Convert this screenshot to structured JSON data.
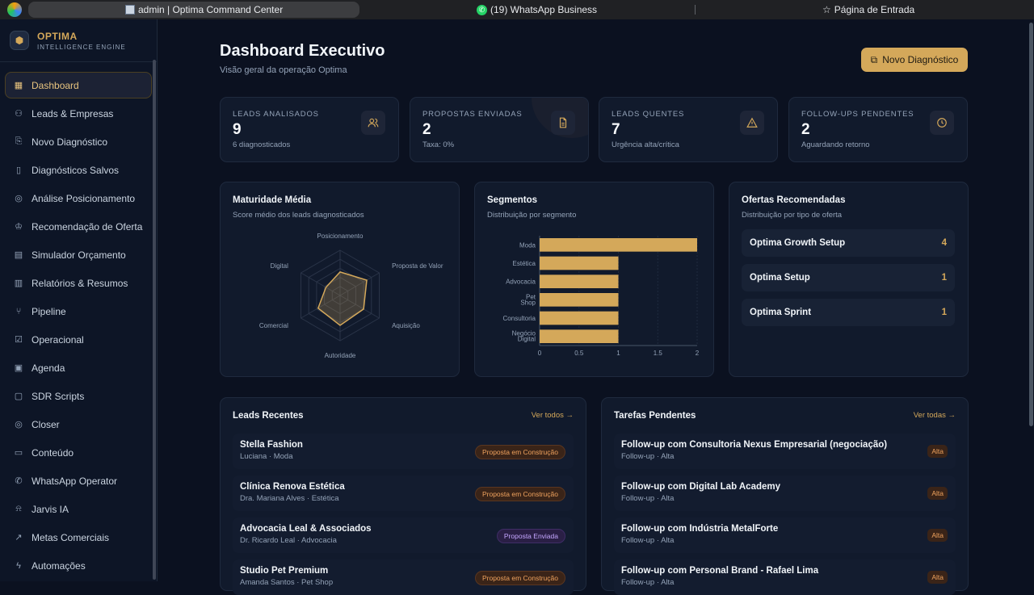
{
  "browser": {
    "active_tab": "admin | Optima Command Center",
    "tab2": "(19) WhatsApp Business",
    "tab3": "Página de Entrada"
  },
  "brand": {
    "name": "OPTIMA",
    "tagline": "INTELLIGENCE ENGINE"
  },
  "sidebar": {
    "items": [
      {
        "label": "Dashboard",
        "icon": "grid-icon"
      },
      {
        "label": "Leads & Empresas",
        "icon": "users-icon"
      },
      {
        "label": "Novo Diagnóstico",
        "icon": "file-plus-icon"
      },
      {
        "label": "Diagnósticos Salvos",
        "icon": "book-icon"
      },
      {
        "label": "Análise Posicionamento",
        "icon": "target-icon"
      },
      {
        "label": "Recomendação de Oferta",
        "icon": "award-icon"
      },
      {
        "label": "Simulador Orçamento",
        "icon": "calculator-icon"
      },
      {
        "label": "Relatórios & Resumos",
        "icon": "bar-chart-icon"
      },
      {
        "label": "Pipeline",
        "icon": "git-branch-icon"
      },
      {
        "label": "Operacional",
        "icon": "checklist-icon"
      },
      {
        "label": "Agenda",
        "icon": "calendar-icon"
      },
      {
        "label": "SDR Scripts",
        "icon": "message-icon"
      },
      {
        "label": "Closer",
        "icon": "target-icon"
      },
      {
        "label": "Conteúdo",
        "icon": "document-icon"
      },
      {
        "label": "WhatsApp Operator",
        "icon": "phone-icon"
      },
      {
        "label": "Jarvis IA",
        "icon": "bot-icon"
      },
      {
        "label": "Metas Comerciais",
        "icon": "trending-up-icon"
      },
      {
        "label": "Automações",
        "icon": "zap-icon"
      }
    ]
  },
  "header": {
    "title": "Dashboard Executivo",
    "subtitle": "Visão geral da operação Optima",
    "new_button": "Novo Diagnóstico"
  },
  "stats": [
    {
      "label": "LEADS ANALISADOS",
      "value": "9",
      "sub": "6 diagnosticados",
      "icon": "users-icon"
    },
    {
      "label": "PROPOSTAS ENVIADAS",
      "value": "2",
      "sub": "Taxa: 0%",
      "icon": "file-icon"
    },
    {
      "label": "LEADS QUENTES",
      "value": "7",
      "sub": "Urgência alta/crítica",
      "icon": "alert-icon"
    },
    {
      "label": "FOLLOW-UPS PENDENTES",
      "value": "2",
      "sub": "Aguardando retorno",
      "icon": "clock-icon"
    }
  ],
  "maturity": {
    "title": "Maturidade Média",
    "subtitle": "Score médio dos leads diagnosticados"
  },
  "segments": {
    "title": "Segmentos",
    "subtitle": "Distribuição por segmento"
  },
  "offers": {
    "title": "Ofertas Recomendadas",
    "subtitle": "Distribuição por tipo de oferta",
    "items": [
      {
        "name": "Optima Growth Setup",
        "count": "4"
      },
      {
        "name": "Optima Setup",
        "count": "1"
      },
      {
        "name": "Optima Sprint",
        "count": "1"
      }
    ]
  },
  "recent_leads": {
    "title": "Leads Recentes",
    "link": "Ver todos →",
    "items": [
      {
        "name": "Stella Fashion",
        "sub": "Luciana · Moda",
        "status": "Proposta em Construção",
        "kind": "construct"
      },
      {
        "name": "Clínica Renova Estética",
        "sub": "Dra. Mariana Alves · Estética",
        "status": "Proposta em Construção",
        "kind": "construct"
      },
      {
        "name": "Advocacia Leal & Associados",
        "sub": "Dr. Ricardo Leal · Advocacia",
        "status": "Proposta Enviada",
        "kind": "sent"
      },
      {
        "name": "Studio Pet Premium",
        "sub": "Amanda Santos · Pet Shop",
        "status": "Proposta em Construção",
        "kind": "construct"
      }
    ]
  },
  "tasks": {
    "title": "Tarefas Pendentes",
    "link": "Ver todas →",
    "items": [
      {
        "title": "Follow-up com Consultoria Nexus Empresarial (negociação)",
        "sub": "Follow-up · Alta",
        "priority": "Alta"
      },
      {
        "title": "Follow-up com Digital Lab Academy",
        "sub": "Follow-up · Alta",
        "priority": "Alta"
      },
      {
        "title": "Follow-up com Indústria MetalForte",
        "sub": "Follow-up · Alta",
        "priority": "Alta"
      },
      {
        "title": "Follow-up com Personal Brand - Rafael Lima",
        "sub": "Follow-up · Alta",
        "priority": "Alta"
      }
    ]
  },
  "chart_data": [
    {
      "type": "radar",
      "axes": [
        "Posicionamento",
        "Proposta de Valor",
        "Aquisição",
        "Autoridade",
        "Comercial",
        "Digital"
      ],
      "values": [
        2.6,
        3.4,
        3.0,
        3.3,
        2.8,
        1.8
      ],
      "max": 5,
      "color": "#d4a85a"
    },
    {
      "type": "bar",
      "orientation": "horizontal",
      "categories": [
        "Moda",
        "Estética",
        "Advocacia",
        "Pet Shop",
        "Consultoria",
        "Negócio Digital"
      ],
      "values": [
        2,
        1,
        1,
        1,
        1,
        1
      ],
      "xlim": [
        0,
        2
      ],
      "xticks": [
        "0",
        "0.5",
        "1",
        "1.5",
        "2"
      ],
      "color": "#d4a85a"
    }
  ]
}
